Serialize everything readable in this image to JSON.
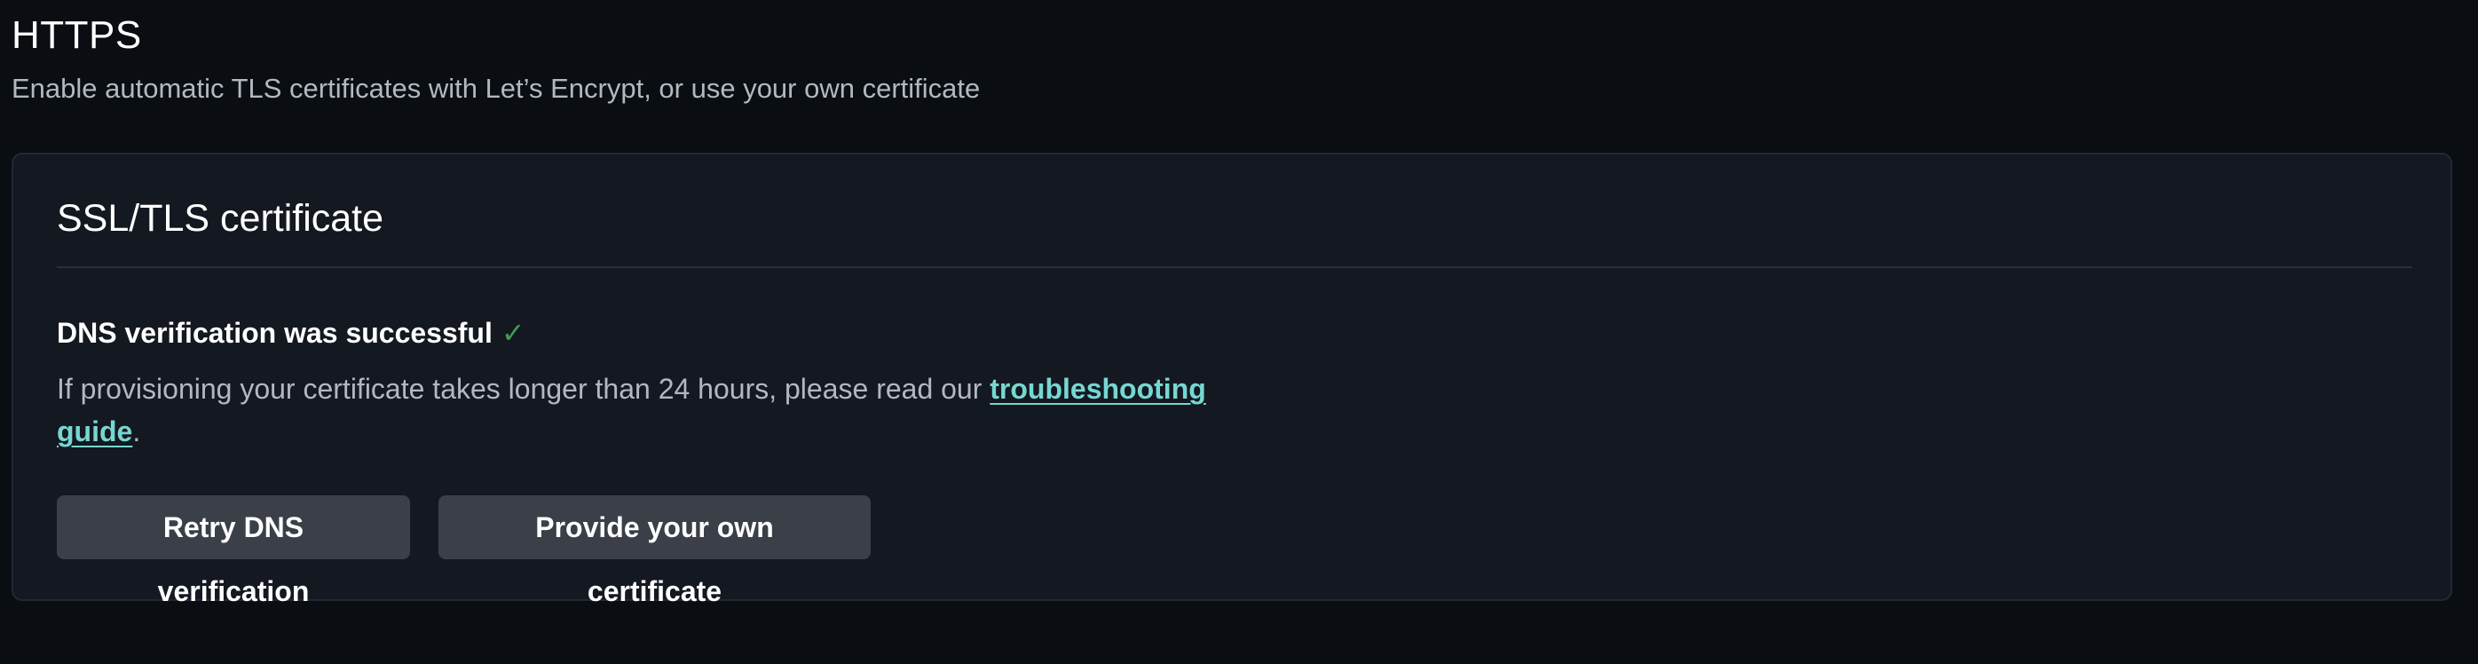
{
  "header": {
    "title": "HTTPS",
    "subtitle": "Enable automatic TLS certificates with Let’s Encrypt, or use your own certificate"
  },
  "card": {
    "title": "SSL/TLS certificate",
    "status": "DNS verification was successful",
    "status_icon": "check-icon",
    "status_color": "#3f9b54",
    "help_prefix": "If provisioning your certificate takes longer than 24 hours, please read our ",
    "help_link": "troubleshooting guide",
    "help_suffix": ".",
    "link_color": "#76d7d2"
  },
  "actions": {
    "retry_label": "Retry DNS verification",
    "provide_label": "Provide your own certificate"
  }
}
